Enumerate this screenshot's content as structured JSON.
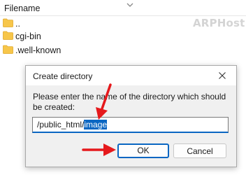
{
  "file_list": {
    "column_header": "Filename",
    "rows": [
      {
        "name": ".."
      },
      {
        "name": "cgi-bin"
      },
      {
        "name": ".well-known"
      }
    ]
  },
  "brand": {
    "text": "ARPHost"
  },
  "dialog": {
    "title": "Create directory",
    "prompt": "Please enter the name of the directory which should be created:",
    "input": {
      "prefix": "/public_html/",
      "selected": "image"
    },
    "ok_label": "OK",
    "cancel_label": "Cancel"
  },
  "colors": {
    "folder": "#f7c64a",
    "accent": "#0a66c2",
    "annotation_arrow": "#e5191c"
  },
  "icons": [
    "chevron-down-icon",
    "folder-icon",
    "close-icon",
    "arrow-annotation"
  ]
}
